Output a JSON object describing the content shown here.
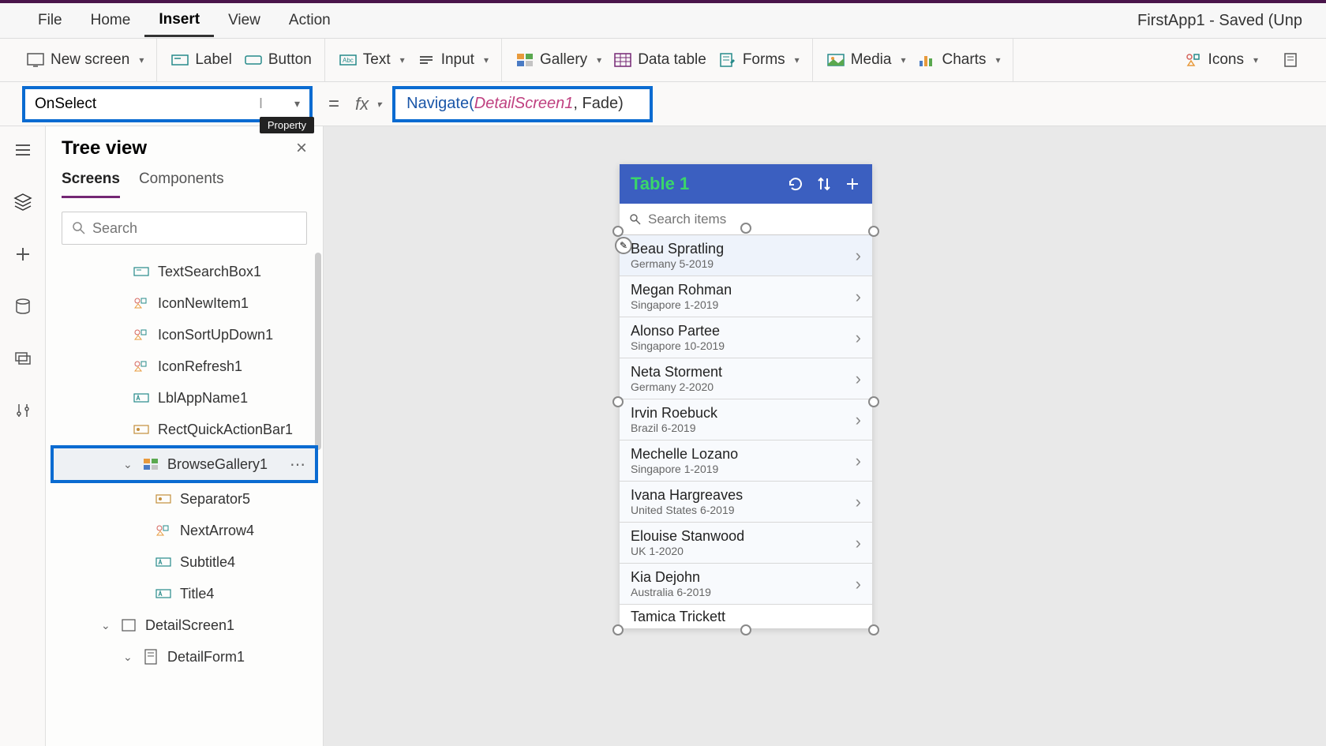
{
  "app": {
    "title": "FirstApp1 - Saved (Unp"
  },
  "menu": {
    "items": [
      "File",
      "Home",
      "Insert",
      "View",
      "Action"
    ],
    "active": "Insert"
  },
  "ribbon": {
    "new_screen": "New screen",
    "label": "Label",
    "button": "Button",
    "text": "Text",
    "input": "Input",
    "gallery": "Gallery",
    "data_table": "Data table",
    "forms": "Forms",
    "media": "Media",
    "charts": "Charts",
    "icons": "Icons"
  },
  "formula_bar": {
    "property": "OnSelect",
    "tooltip": "Property",
    "fn_name": "Navigate",
    "fn_arg": "DetailScreen1",
    "fn_rest": ", Fade)"
  },
  "tree_view": {
    "title": "Tree view",
    "tabs": [
      "Screens",
      "Components"
    ],
    "search_placeholder": "Search",
    "items": [
      {
        "label": "TextSearchBox1",
        "icon": "textbox"
      },
      {
        "label": "IconNewItem1",
        "icon": "group"
      },
      {
        "label": "IconSortUpDown1",
        "icon": "group"
      },
      {
        "label": "IconRefresh1",
        "icon": "group"
      },
      {
        "label": "LblAppName1",
        "icon": "label"
      },
      {
        "label": "RectQuickActionBar1",
        "icon": "rect"
      }
    ],
    "highlighted": "BrowseGallery1",
    "gallery_children": [
      {
        "label": "Separator5",
        "icon": "rect"
      },
      {
        "label": "NextArrow4",
        "icon": "group"
      },
      {
        "label": "Subtitle4",
        "icon": "label"
      },
      {
        "label": "Title4",
        "icon": "label"
      }
    ],
    "screen2": "DetailScreen1",
    "form": "DetailForm1"
  },
  "phone": {
    "title": "Table 1",
    "search_placeholder": "Search items",
    "items": [
      {
        "name": "Beau Spratling",
        "sub": "Germany 5-2019"
      },
      {
        "name": "Megan Rohman",
        "sub": "Singapore 1-2019"
      },
      {
        "name": "Alonso Partee",
        "sub": "Singapore 10-2019"
      },
      {
        "name": "Neta Storment",
        "sub": "Germany 2-2020"
      },
      {
        "name": "Irvin Roebuck",
        "sub": "Brazil 6-2019"
      },
      {
        "name": "Mechelle Lozano",
        "sub": "Singapore 1-2019"
      },
      {
        "name": "Ivana Hargreaves",
        "sub": "United States 6-2019"
      },
      {
        "name": "Elouise Stanwood",
        "sub": "UK 1-2020"
      },
      {
        "name": "Kia Dejohn",
        "sub": "Australia 6-2019"
      }
    ],
    "last_partial": "Tamica Trickett"
  }
}
